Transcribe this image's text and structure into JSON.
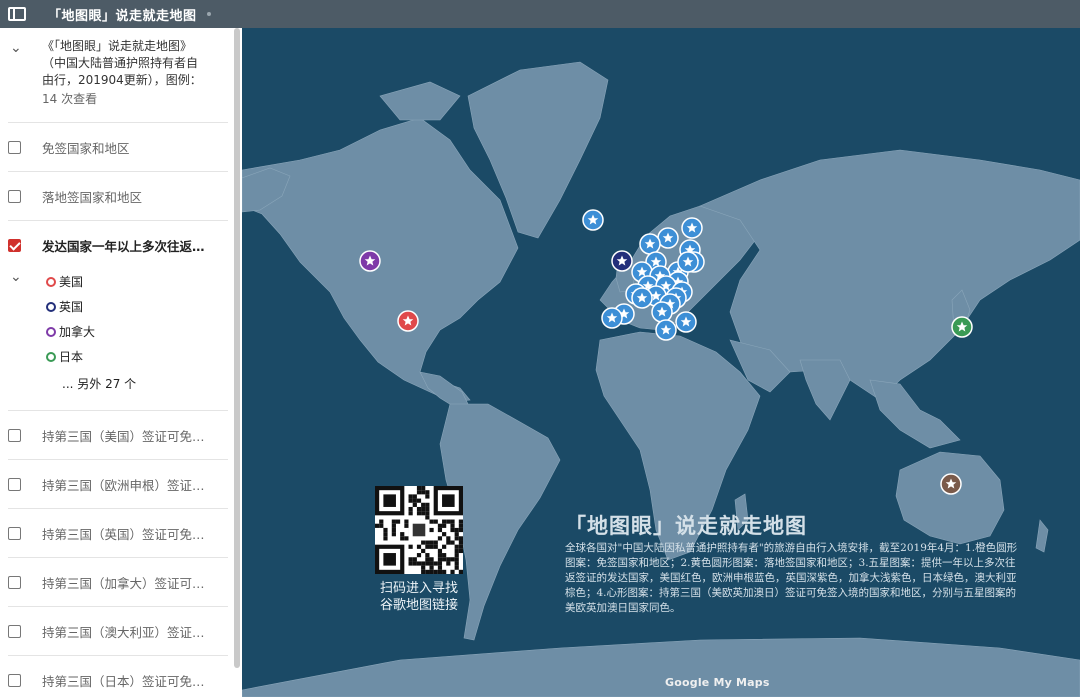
{
  "topbar": {
    "title": "「地图眼」说走就走地图"
  },
  "sidebar": {
    "header": {
      "title": "《「地图眼」说走就走地图》",
      "desc_line1": "（中国大陆普通护照持有者自",
      "desc_line2": "由行，201904更新），图例：",
      "views": "14 次查看"
    },
    "layers": [
      {
        "label": "免签国家和地区",
        "checked": false
      },
      {
        "label": "落地签国家和地区",
        "checked": false
      },
      {
        "label": "发达国家一年以上多次往返…",
        "checked": true
      },
      {
        "label": "持第三国（美国）签证可免…",
        "checked": false
      },
      {
        "label": "持第三国（欧洲申根）签证…",
        "checked": false
      },
      {
        "label": "持第三国（英国）签证可免…",
        "checked": false
      },
      {
        "label": "持第三国（加拿大）签证可…",
        "checked": false
      },
      {
        "label": "持第三国（澳大利亚）签证…",
        "checked": false
      },
      {
        "label": "持第三国（日本）签证可免…",
        "checked": false
      }
    ],
    "legend": {
      "items": [
        {
          "label": "美国",
          "color": "#e0494a"
        },
        {
          "label": "英国",
          "color": "#232f7a"
        },
        {
          "label": "加拿大",
          "color": "#7e3aa8"
        },
        {
          "label": "日本",
          "color": "#3a9a55"
        }
      ],
      "more": "... 另外 27 个"
    }
  },
  "map": {
    "qr_text_line1": "扫码进入寻找",
    "qr_text_line2": "谷歌地图链接",
    "overlay_title": "「地图眼」说走就走地图",
    "overlay_desc": "全球各国对\"中国大陆因私普通护照持有者\"的旅游自由行入境安排，截至2019年4月：1.橙色圆形图案：免签国家和地区；2.黄色圆形图案：落地签国家和地区；3.五星图案：提供一年以上多次往返签证的发达国家，美国红色，欧洲申根蓝色，英国深紫色，加拿大浅紫色，日本绿色，澳大利亚棕色；4.心形图案：持第三国（美欧英加澳日）签证可免签入境的国家和地区，分别与五星图案的美欧英加澳日国家同色。",
    "watermark": "Google My Maps",
    "colors": {
      "ocean": "#1b4a66",
      "land": "#6e8ea6",
      "schengen": "#3d8fd6",
      "usa": "#e0494a",
      "uk": "#232f7a",
      "canada": "#7e3aa8",
      "japan": "#3a9a55",
      "australia": "#7a5a4a"
    }
  }
}
